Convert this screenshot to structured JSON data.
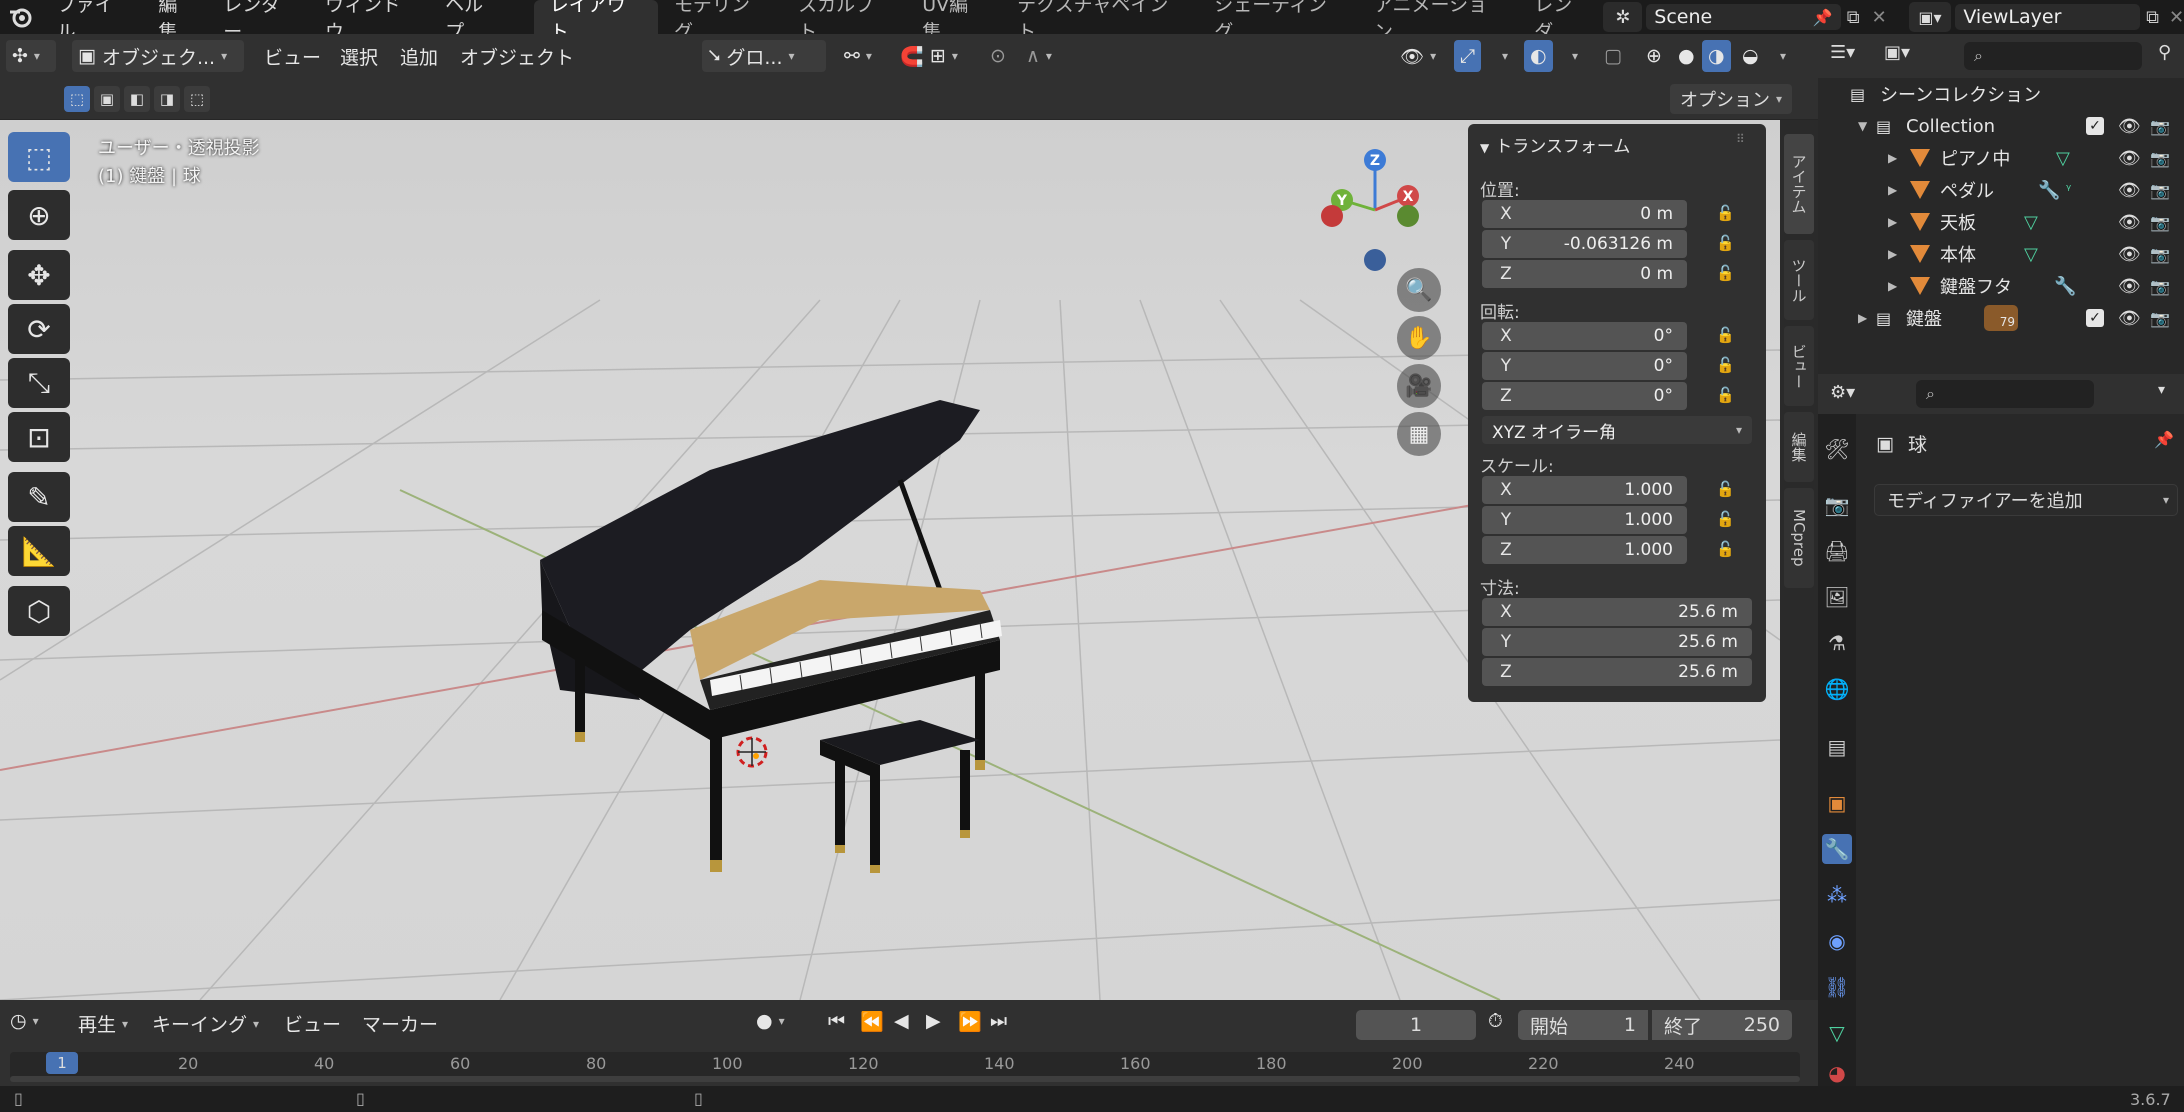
{
  "topbar": {
    "menus": [
      "ファイル",
      "編集",
      "レンダー",
      "ウィンドウ",
      "ヘルプ"
    ],
    "workspaces": [
      "レイアウト",
      "モデリング",
      "スカルプト",
      "UV編集",
      "テクスチャペイント",
      "シェーディング",
      "アニメーション",
      "レンダ"
    ],
    "scene": "Scene",
    "viewlayer": "ViewLayer"
  },
  "vp_header": {
    "mode": "オブジェク...",
    "menus": [
      "ビュー",
      "選択",
      "追加",
      "オブジェクト"
    ],
    "orientation": "グロ...",
    "options": "オプション"
  },
  "viewport": {
    "view_name": "ユーザー・透視投影",
    "object_info": "(1) 鍵盤 | 球",
    "gizmo": {
      "z": "Z",
      "y": "Y",
      "x": "X"
    }
  },
  "npanel": {
    "title": "トランスフォーム",
    "location_label": "位置:",
    "location": [
      {
        "axis": "X",
        "value": "0 m"
      },
      {
        "axis": "Y",
        "value": "-0.063126 m"
      },
      {
        "axis": "Z",
        "value": "0 m"
      }
    ],
    "rotation_label": "回転:",
    "rotation": [
      {
        "axis": "X",
        "value": "0°"
      },
      {
        "axis": "Y",
        "value": "0°"
      },
      {
        "axis": "Z",
        "value": "0°"
      }
    ],
    "rotation_mode": "XYZ オイラー角",
    "scale_label": "スケール:",
    "scale": [
      {
        "axis": "X",
        "value": "1.000"
      },
      {
        "axis": "Y",
        "value": "1.000"
      },
      {
        "axis": "Z",
        "value": "1.000"
      }
    ],
    "dimensions_label": "寸法:",
    "dimensions": [
      {
        "axis": "X",
        "value": "25.6 m"
      },
      {
        "axis": "Y",
        "value": "25.6 m"
      },
      {
        "axis": "Z",
        "value": "25.6 m"
      }
    ],
    "tabs": [
      "アイテム",
      "ツール",
      "ビュー",
      "編集",
      "MCprep"
    ]
  },
  "outliner": {
    "scene_collection": "シーンコレクション",
    "collection": "Collection",
    "items": [
      "ピアノ中",
      "ペダル",
      "天板",
      "本体",
      "鍵盤フタ"
    ],
    "keyboard": "鍵盤",
    "keyboard_badge": "79"
  },
  "properties": {
    "object_name": "球",
    "add_modifier": "モディファイアーを追加"
  },
  "timeline": {
    "play": "再生",
    "keying": "キーイング",
    "view": "ビュー",
    "marker": "マーカー",
    "current_frame": "1",
    "start_label": "開始",
    "start": "1",
    "end_label": "終了",
    "end": "250",
    "ruler": [
      "1",
      "20",
      "40",
      "60",
      "80",
      "100",
      "120",
      "140",
      "160",
      "180",
      "200",
      "220",
      "240"
    ]
  },
  "status": {
    "version": "3.6.7"
  },
  "colors": {
    "accent": "#4772b3",
    "object_orange": "#e28a3a",
    "mesh_green": "#4fd1a0"
  }
}
